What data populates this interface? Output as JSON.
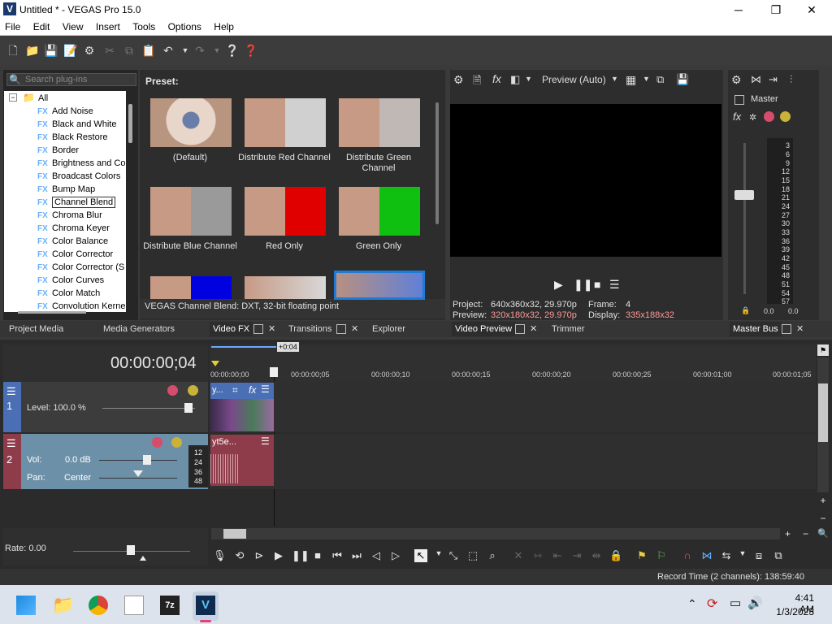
{
  "window": {
    "title": "Untitled * - VEGAS Pro 15.0",
    "logo": "V"
  },
  "menu": [
    "File",
    "Edit",
    "View",
    "Insert",
    "Tools",
    "Options",
    "Help"
  ],
  "plugins": {
    "search_placeholder": "Search plug-ins",
    "root": "All",
    "items": [
      "Add Noise",
      "Black and White",
      "Black Restore",
      "Border",
      "Brightness and Co",
      "Broadcast Colors",
      "Bump Map",
      "Channel Blend",
      "Chroma Blur",
      "Chroma Keyer",
      "Color Balance",
      "Color Corrector",
      "Color Corrector (S",
      "Color Curves",
      "Color Match",
      "Convolution Kerne"
    ],
    "selected": "Channel Blend"
  },
  "presets": {
    "label": "Preset:",
    "items": [
      "(Default)",
      "Distribute Red Channel",
      "Distribute Green Channel",
      "Distribute Blue Channel",
      "Red Only",
      "Green Only"
    ],
    "status": "VEGAS Channel Blend: DXT, 32-bit floating point"
  },
  "preview": {
    "mode": "Preview (Auto)",
    "project_label": "Project:",
    "project_value": "640x360x32, 29.970p",
    "frame_label": "Frame:",
    "frame_value": "4",
    "preview_label": "Preview:",
    "preview_value": "320x180x32, 29.970p",
    "display_label": "Display:",
    "display_value": "335x188x32"
  },
  "master": {
    "label": "Master",
    "scale": [
      "3",
      "6",
      "9",
      "12",
      "15",
      "18",
      "21",
      "24",
      "27",
      "30",
      "33",
      "36",
      "39",
      "42",
      "45",
      "48",
      "51",
      "54",
      "57"
    ],
    "left_value": "0.0",
    "right_value": "0.0"
  },
  "tabs": {
    "project_media": "Project Media",
    "media_generators": "Media Generators",
    "video_fx": "Video FX",
    "transitions": "Transitions",
    "explorer": "Explorer",
    "video_preview": "Video Preview",
    "trimmer": "Trimmer",
    "master_bus": "Master Bus"
  },
  "timeline": {
    "timecode": "00:00:00;04",
    "marker_offset": "+0:04",
    "ruler": [
      "00:00:00;00",
      "00:00:00;05",
      "00:00:00;10",
      "00:00:00;15",
      "00:00:00;20",
      "00:00:00;25",
      "00:00:01;00",
      "00:00:01;05"
    ],
    "track1": {
      "number": "1",
      "level_label": "Level: 100.0 %",
      "clip_label": "y..."
    },
    "track2": {
      "number": "2",
      "vol_label": "Vol:",
      "vol_value": "0.0 dB",
      "pan_label": "Pan:",
      "pan_value": "Center",
      "clip_label": "yt5e...",
      "db_marks": [
        "12",
        "24",
        "36",
        "48"
      ]
    },
    "rate": "Rate: 0.00"
  },
  "status": {
    "record_time": "Record Time (2 channels): 138:59:40"
  },
  "taskbar": {
    "time": "4:41 AM",
    "date": "1/3/2023"
  }
}
